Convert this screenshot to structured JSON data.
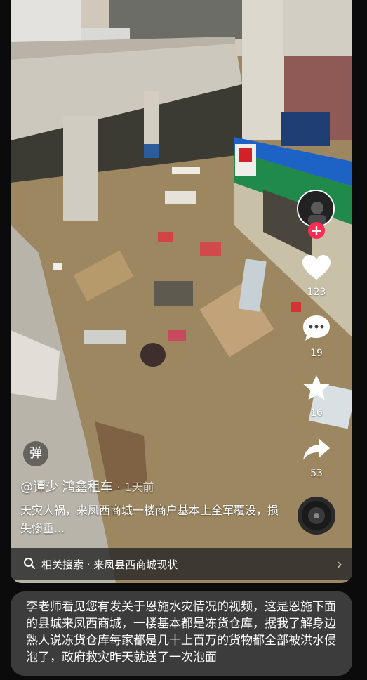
{
  "video": {
    "danmu_label": "弹",
    "author": "@谭少 鸿鑫租车",
    "separator": "·",
    "time_ago": "1天前",
    "caption": "天灾人祸，来凤西商城一楼商户基本上全军覆没，损失惨重...",
    "related_search": "相关搜索 · 来凤县西商城现状"
  },
  "actions": {
    "like_count": "123",
    "comment_count": "19",
    "favorite_count": "16",
    "share_count": "53"
  },
  "comment": {
    "text": "李老师看见您有发关于恩施水灾情况的视频，这是恩施下面的县城来凤西商城，一楼基本都是冻货仓库，据我了解身边熟人说冻货仓库每家都是几十上百万的货物都全部被洪水侵泡了，政府救灾昨天就送了一次泡面"
  },
  "colors": {
    "accent": "#fe2c55",
    "flood_water": "#9c8761",
    "shop_awning": "#1d63c6"
  }
}
